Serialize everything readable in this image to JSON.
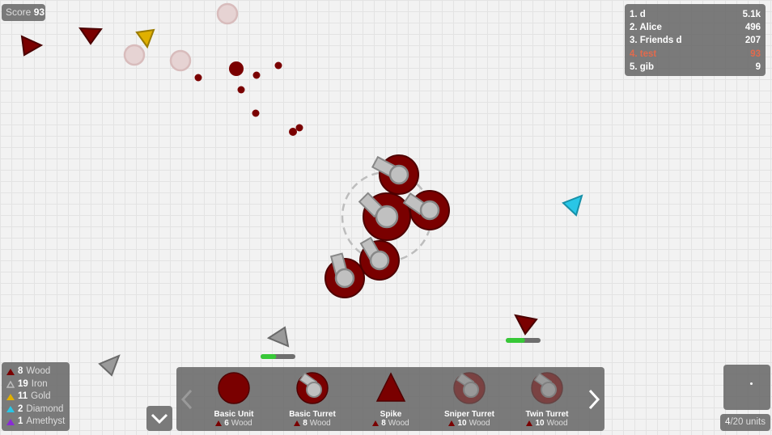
{
  "score": {
    "label": "Score",
    "value": "93"
  },
  "leaderboard": [
    {
      "name": "1. d",
      "score": "5.1k",
      "me": false
    },
    {
      "name": "2. Alice",
      "score": "496",
      "me": false
    },
    {
      "name": "3. Friends d",
      "score": "207",
      "me": false
    },
    {
      "name": "4. test",
      "score": "93",
      "me": true
    },
    {
      "name": "5. gib",
      "score": "9",
      "me": false
    }
  ],
  "resources": [
    {
      "count": "8",
      "name": "Wood",
      "color": "#7a0000"
    },
    {
      "count": "19",
      "name": "Iron",
      "color": "#bbbbbb"
    },
    {
      "count": "11",
      "name": "Gold",
      "color": "#e0b000"
    },
    {
      "count": "2",
      "name": "Diamond",
      "color": "#29c6e6"
    },
    {
      "count": "1",
      "name": "Amethyst",
      "color": "#8a2bd6"
    }
  ],
  "shop": {
    "items": [
      {
        "name": "Basic Unit",
        "cost": "6",
        "resource": "Wood",
        "icon": "basic-unit-icon",
        "affordable": true
      },
      {
        "name": "Basic Turret",
        "cost": "8",
        "resource": "Wood",
        "icon": "basic-turret-icon",
        "affordable": true
      },
      {
        "name": "Spike",
        "cost": "8",
        "resource": "Wood",
        "icon": "spike-icon",
        "affordable": true
      },
      {
        "name": "Sniper Turret",
        "cost": "10",
        "resource": "Wood",
        "icon": "sniper-turret-icon",
        "affordable": false
      },
      {
        "name": "Twin Turret",
        "cost": "10",
        "resource": "Wood",
        "icon": "twin-turret-icon",
        "affordable": false
      }
    ],
    "prev_icon": "chevron-left-icon",
    "next_icon": "chevron-right-icon"
  },
  "collapse_icon": "chevron-down-icon",
  "units": {
    "current": "4",
    "max": "20",
    "label": "units"
  },
  "colors": {
    "player": "#7a0000",
    "panel": "#696969",
    "turret": "#c0c0c0",
    "self_highlight": "#e26a4d",
    "health": "#37c837"
  },
  "world": {
    "health_bars": [
      {
        "fill": 0.45
      },
      {
        "fill": 0.55
      }
    ]
  }
}
